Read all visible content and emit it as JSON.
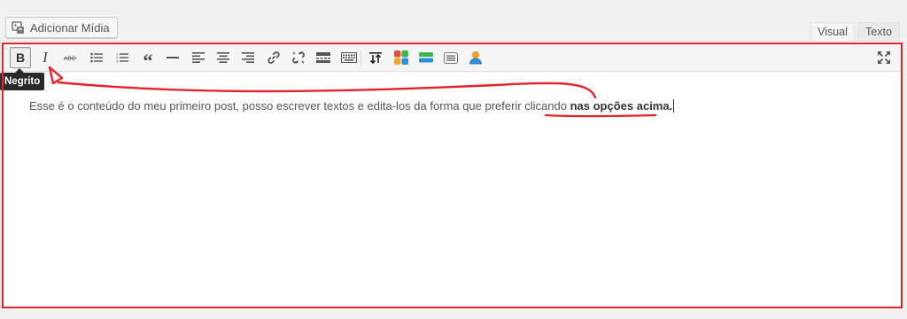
{
  "media_button": {
    "label": "Adicionar Mídia",
    "icon": "media-upload-icon"
  },
  "tabs": [
    {
      "label": "Visual",
      "active": true
    },
    {
      "label": "Texto",
      "active": false
    }
  ],
  "toolbar": {
    "items": [
      {
        "name": "bold",
        "icon": "bold-icon",
        "active": true
      },
      {
        "name": "italic",
        "icon": "italic-icon"
      },
      {
        "name": "strikethrough",
        "icon": "strikethrough-icon"
      },
      {
        "name": "bulleted-list",
        "icon": "bulleted-list-icon"
      },
      {
        "name": "numbered-list",
        "icon": "numbered-list-icon"
      },
      {
        "name": "blockquote",
        "icon": "quote-icon"
      },
      {
        "name": "horizontal-line",
        "icon": "horizontal-line-icon"
      },
      {
        "name": "align-left",
        "icon": "align-left-icon"
      },
      {
        "name": "align-center",
        "icon": "align-center-icon"
      },
      {
        "name": "align-right",
        "icon": "align-right-icon"
      },
      {
        "name": "insert-link",
        "icon": "link-icon"
      },
      {
        "name": "remove-link",
        "icon": "unlink-icon"
      },
      {
        "name": "read-more",
        "icon": "read-more-icon"
      },
      {
        "name": "toolbar-toggle",
        "icon": "keyboard-icon"
      },
      {
        "name": "plugin-1",
        "icon": "arrows-icon"
      },
      {
        "name": "plugin-2",
        "icon": "color-grid-icon"
      },
      {
        "name": "plugin-3",
        "icon": "color-bars-icon"
      },
      {
        "name": "plugin-4",
        "icon": "list-box-icon"
      },
      {
        "name": "plugin-5",
        "icon": "user-icon"
      },
      {
        "name": "fullscreen",
        "icon": "fullscreen-icon"
      }
    ],
    "tooltip": "Negrito"
  },
  "content": {
    "text_plain": "Esse é o conteúdo do meu primeiro post, posso escrever textos e edita-los da forma que preferir clicando ",
    "text_bold": "nas opções  acima."
  },
  "colors": {
    "annotation_red": "#e4232b",
    "tooltip_bg": "#2a2a2a"
  }
}
